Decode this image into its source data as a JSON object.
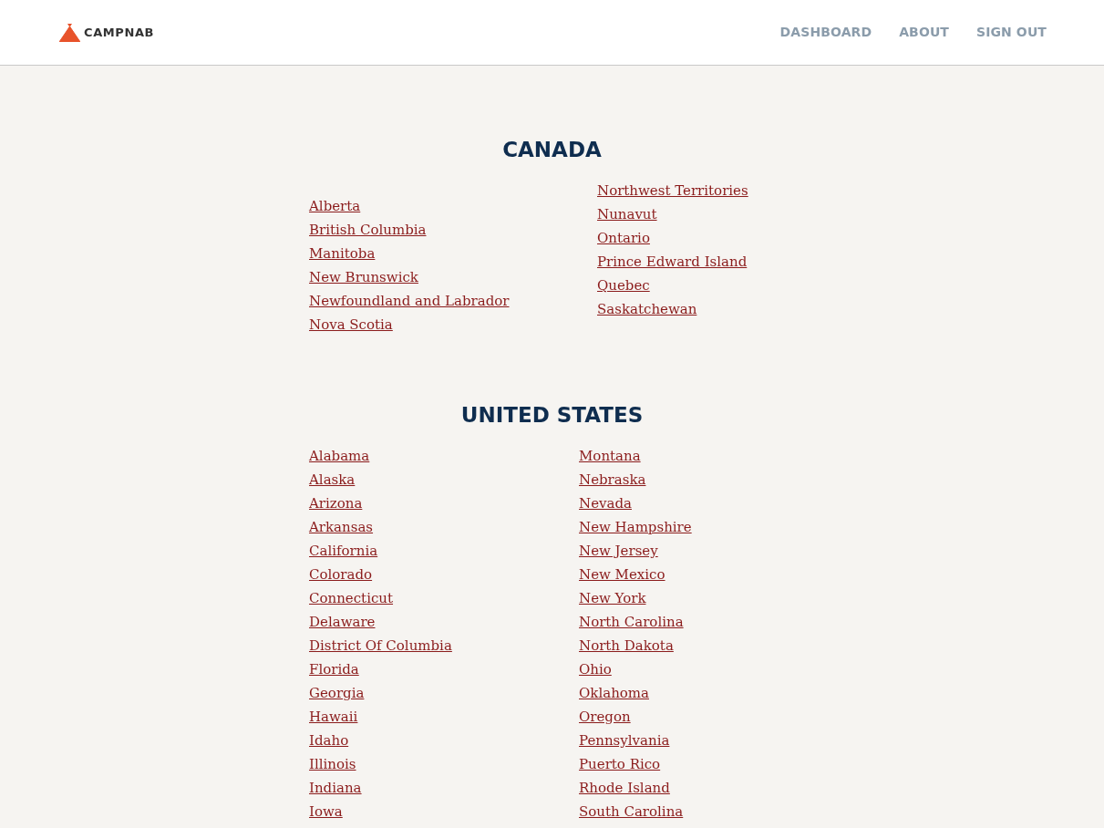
{
  "header": {
    "logo": {
      "text": "CAMPNAB"
    },
    "nav": [
      {
        "label": "DASHBOARD"
      },
      {
        "label": "ABOUT"
      },
      {
        "label": "SIGN OUT"
      }
    ]
  },
  "sections": [
    {
      "title": "CANADA",
      "columns": [
        [
          "Alberta",
          "British Columbia",
          "Manitoba",
          "New Brunswick",
          "Newfoundland and Labrador",
          "Nova Scotia"
        ],
        [
          "Northwest Territories",
          "Nunavut",
          "Ontario",
          "Prince Edward Island",
          "Quebec",
          "Saskatchewan"
        ]
      ]
    },
    {
      "title": "UNITED STATES",
      "columns": [
        [
          "Alabama",
          "Alaska",
          "Arizona",
          "Arkansas",
          "California",
          "Colorado",
          "Connecticut",
          "Delaware",
          "District Of Columbia",
          "Florida",
          "Georgia",
          "Hawaii",
          "Idaho",
          "Illinois",
          "Indiana",
          "Iowa"
        ],
        [
          "Montana",
          "Nebraska",
          "Nevada",
          "New Hampshire",
          "New Jersey",
          "New Mexico",
          "New York",
          "North Carolina",
          "North Dakota",
          "Ohio",
          "Oklahoma",
          "Oregon",
          "Pennsylvania",
          "Puerto Rico",
          "Rhode Island",
          "South Carolina"
        ]
      ]
    }
  ]
}
